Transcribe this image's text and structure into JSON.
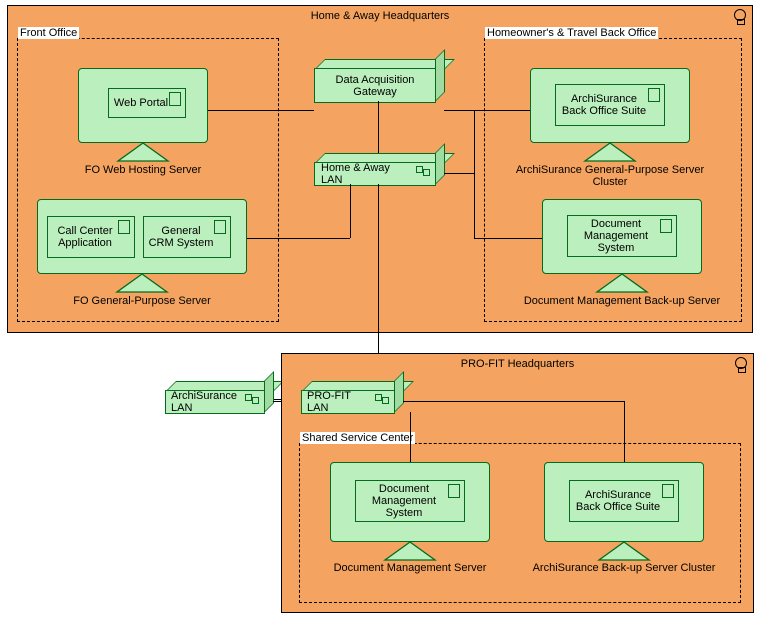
{
  "hq1": {
    "title": "Home & Away Headquarters",
    "front_office_label": "Front Office",
    "back_office_label": "Homeowner's & Travel Back Office",
    "gateway": "Data Acquisition Gateway",
    "lan": "Home & Away LAN",
    "fo_web": {
      "device": "FO Web Hosting Server",
      "artifact": "Web Portal"
    },
    "fo_gp": {
      "device": "FO General-Purpose Server",
      "artifact1": "Call Center Application",
      "artifact2": "General CRM System"
    },
    "bo_cluster": {
      "device": "ArchiSurance General-Purpose Server Cluster",
      "artifact": "ArchiSurance Back Office Suite"
    },
    "bo_dms": {
      "device": "Document Management Back-up Server",
      "artifact": "Document Management System"
    }
  },
  "archisurance_lan": "ArchiSurance LAN",
  "hq2": {
    "title": "PRO-FIT Headquarters",
    "lan": "PRO-FIT LAN",
    "ssc_label": "Shared Service Center",
    "dms": {
      "device": "Document Management Server",
      "artifact": "Document Management System"
    },
    "cluster": {
      "device": "ArchiSurance Back-up Server Cluster",
      "artifact": "ArchiSurance Back Office Suite"
    }
  }
}
